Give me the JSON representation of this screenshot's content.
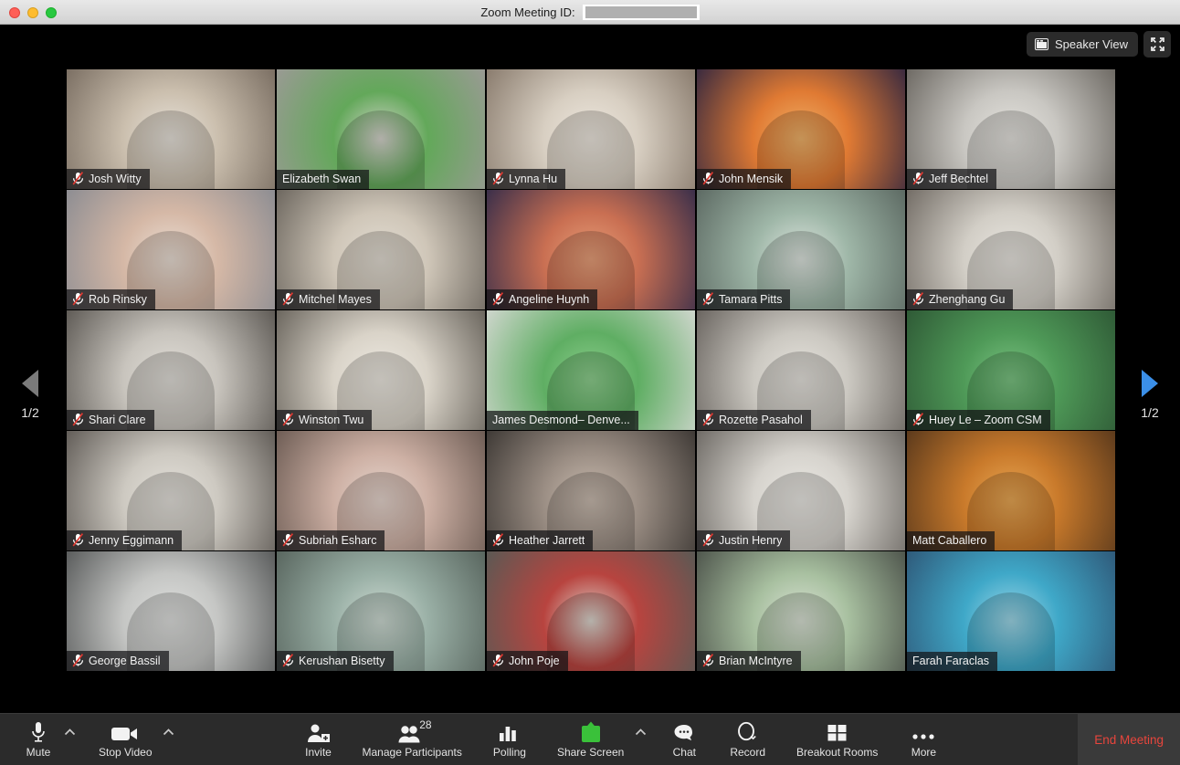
{
  "window": {
    "title_prefix": "Zoom Meeting ID:",
    "meeting_id_redacted": "",
    "traffic_lights": [
      "close-button",
      "minimize-button",
      "maximize-button"
    ]
  },
  "stage": {
    "view_toggle": {
      "label": "Speaker View",
      "icon": "speaker-view-icon"
    },
    "fullscreen": {
      "icon": "fullscreen-icon"
    },
    "pager_left": {
      "page_label": "1/2",
      "icon": "chevron-left-triangle",
      "enabled": false,
      "color": "#7b7b7b"
    },
    "pager_right": {
      "page_label": "1/2",
      "icon": "chevron-right-triangle",
      "enabled": true,
      "color": "#3b8fe8"
    },
    "active_speaker_border_color": "#e9e92b"
  },
  "participants": [
    {
      "name": "Josh Witty",
      "muted": true,
      "active": false,
      "bg": "office-bright",
      "c1": "#cbbfae",
      "c2": "#7b6f63",
      "c3": "#e9e4dc"
    },
    {
      "name": "Elizabeth Swan",
      "muted": false,
      "active": false,
      "bg": "office-green",
      "c1": "#63a85a",
      "c2": "#9a9a94",
      "c3": "#d8d6cf"
    },
    {
      "name": "Lynna Hu",
      "muted": true,
      "active": false,
      "bg": "office-warm",
      "c1": "#d8cfc2",
      "c2": "#8a7c6e",
      "c3": "#efe9e0"
    },
    {
      "name": "John Mensik",
      "muted": true,
      "active": false,
      "bg": "sunset-vbg",
      "c1": "#e07a33",
      "c2": "#3a2a3f",
      "c3": "#f0b36a"
    },
    {
      "name": "Jeff Bechtel",
      "muted": true,
      "active": false,
      "bg": "office-grey",
      "c1": "#c9c7c2",
      "c2": "#6e6a64",
      "c3": "#e6e4df"
    },
    {
      "name": "Rob Rinsky",
      "muted": true,
      "active": false,
      "bg": "closeup-face",
      "c1": "#d5b8a6",
      "c2": "#8d8d92",
      "c3": "#ece0d6"
    },
    {
      "name": "Mitchel Mayes",
      "muted": true,
      "active": false,
      "bg": "office-desk",
      "c1": "#cfc6b8",
      "c2": "#6d675f",
      "c3": "#e4ded4"
    },
    {
      "name": "Angeline Huynh",
      "muted": true,
      "active": false,
      "bg": "bridge-vbg",
      "c1": "#c96f52",
      "c2": "#3b2f4a",
      "c3": "#e8a07a"
    },
    {
      "name": "Tamara Pitts",
      "muted": true,
      "active": false,
      "bg": "office-teal",
      "c1": "#9fb7a8",
      "c2": "#5d6a63",
      "c3": "#dfe6e0"
    },
    {
      "name": "Zhenghang Gu",
      "muted": true,
      "active": false,
      "bg": "office-wide",
      "c1": "#d2cec6",
      "c2": "#736d66",
      "c3": "#eae7e1"
    },
    {
      "name": "Shari Clare",
      "muted": true,
      "active": false,
      "bg": "office-cube",
      "c1": "#c8c4bd",
      "c2": "#5f5b56",
      "c3": "#e3e0da"
    },
    {
      "name": "Winston Twu",
      "muted": true,
      "active": false,
      "bg": "home-window",
      "c1": "#d9d3c8",
      "c2": "#6b665e",
      "c3": "#efebe3"
    },
    {
      "name": "James Desmond– Denve...",
      "muted": false,
      "active": false,
      "bg": "greenscreen",
      "c1": "#5fae63",
      "c2": "#cfd6cd",
      "c3": "#8fd08f"
    },
    {
      "name": "Rozette Pasahol",
      "muted": true,
      "active": false,
      "bg": "office-light",
      "c1": "#cbc8c1",
      "c2": "#6a6560",
      "c3": "#e8e5df"
    },
    {
      "name": "Huey Le – Zoom CSM",
      "muted": true,
      "active": false,
      "bg": "greenwall",
      "c1": "#4f9a58",
      "c2": "#2f5a36",
      "c3": "#7cc483"
    },
    {
      "name": "Jenny Eggimann",
      "muted": true,
      "active": false,
      "bg": "office-open",
      "c1": "#cdc9c1",
      "c2": "#625d58",
      "c3": "#e6e3dd"
    },
    {
      "name": "Subriah Esharc",
      "muted": true,
      "active": false,
      "bg": "office-pink",
      "c1": "#cdb0a4",
      "c2": "#6e5d55",
      "c3": "#e8d7cf"
    },
    {
      "name": "Heather Jarrett",
      "muted": true,
      "active": false,
      "bg": "home-dark",
      "c1": "#9b8e84",
      "c2": "#3f3a36",
      "c3": "#cabcb0"
    },
    {
      "name": "Justin Henry",
      "muted": true,
      "active": false,
      "bg": "office-plain",
      "c1": "#d6d3cd",
      "c2": "#6f6b66",
      "c3": "#eceae5"
    },
    {
      "name": "Matt Caballero",
      "muted": false,
      "active": false,
      "bg": "autumn-vbg",
      "c1": "#c97a2b",
      "c2": "#5c3a1c",
      "c3": "#e9a855"
    },
    {
      "name": "George Bassil",
      "muted": true,
      "active": false,
      "bg": "office-cool",
      "c1": "#c5c6c4",
      "c2": "#5a5c5c",
      "c3": "#e0e1df"
    },
    {
      "name": "Kerushan Bisetty",
      "muted": true,
      "active": false,
      "bg": "outdoor-yard",
      "c1": "#9ab0a6",
      "c2": "#59665f",
      "c3": "#cfdcd4"
    },
    {
      "name": "John Poje",
      "muted": true,
      "active": false,
      "bg": "home-red",
      "c1": "#b8443f",
      "c2": "#5b5954",
      "c3": "#ddd8d0"
    },
    {
      "name": "Brian McIntyre",
      "muted": true,
      "active": false,
      "bg": "office-two",
      "c1": "#a8c0a0",
      "c2": "#4f564d",
      "c3": "#dbe3d6"
    },
    {
      "name": "Farah Faraclas",
      "muted": false,
      "active": true,
      "bg": "lake-vbg",
      "c1": "#3fa8c8",
      "c2": "#2f5a7a",
      "c3": "#9fd8e8"
    }
  ],
  "toolbar": {
    "mute": {
      "label": "Mute",
      "icon": "microphone-icon"
    },
    "stop_video": {
      "label": "Stop Video",
      "icon": "video-camera-icon"
    },
    "invite": {
      "label": "Invite",
      "icon": "person-add-icon"
    },
    "participants": {
      "label": "Manage Participants",
      "icon": "people-icon",
      "count": "28"
    },
    "polling": {
      "label": "Polling",
      "icon": "bar-chart-icon"
    },
    "share": {
      "label": "Share Screen",
      "icon": "share-screen-icon",
      "accent": "#3ac13a"
    },
    "chat": {
      "label": "Chat",
      "icon": "chat-bubble-icon"
    },
    "record": {
      "label": "Record",
      "icon": "record-circle-icon"
    },
    "breakout": {
      "label": "Breakout Rooms",
      "icon": "grid-squares-icon"
    },
    "more": {
      "label": "More",
      "icon": "ellipsis-icon"
    },
    "end": {
      "label": "End Meeting",
      "color": "#e8453c"
    }
  }
}
